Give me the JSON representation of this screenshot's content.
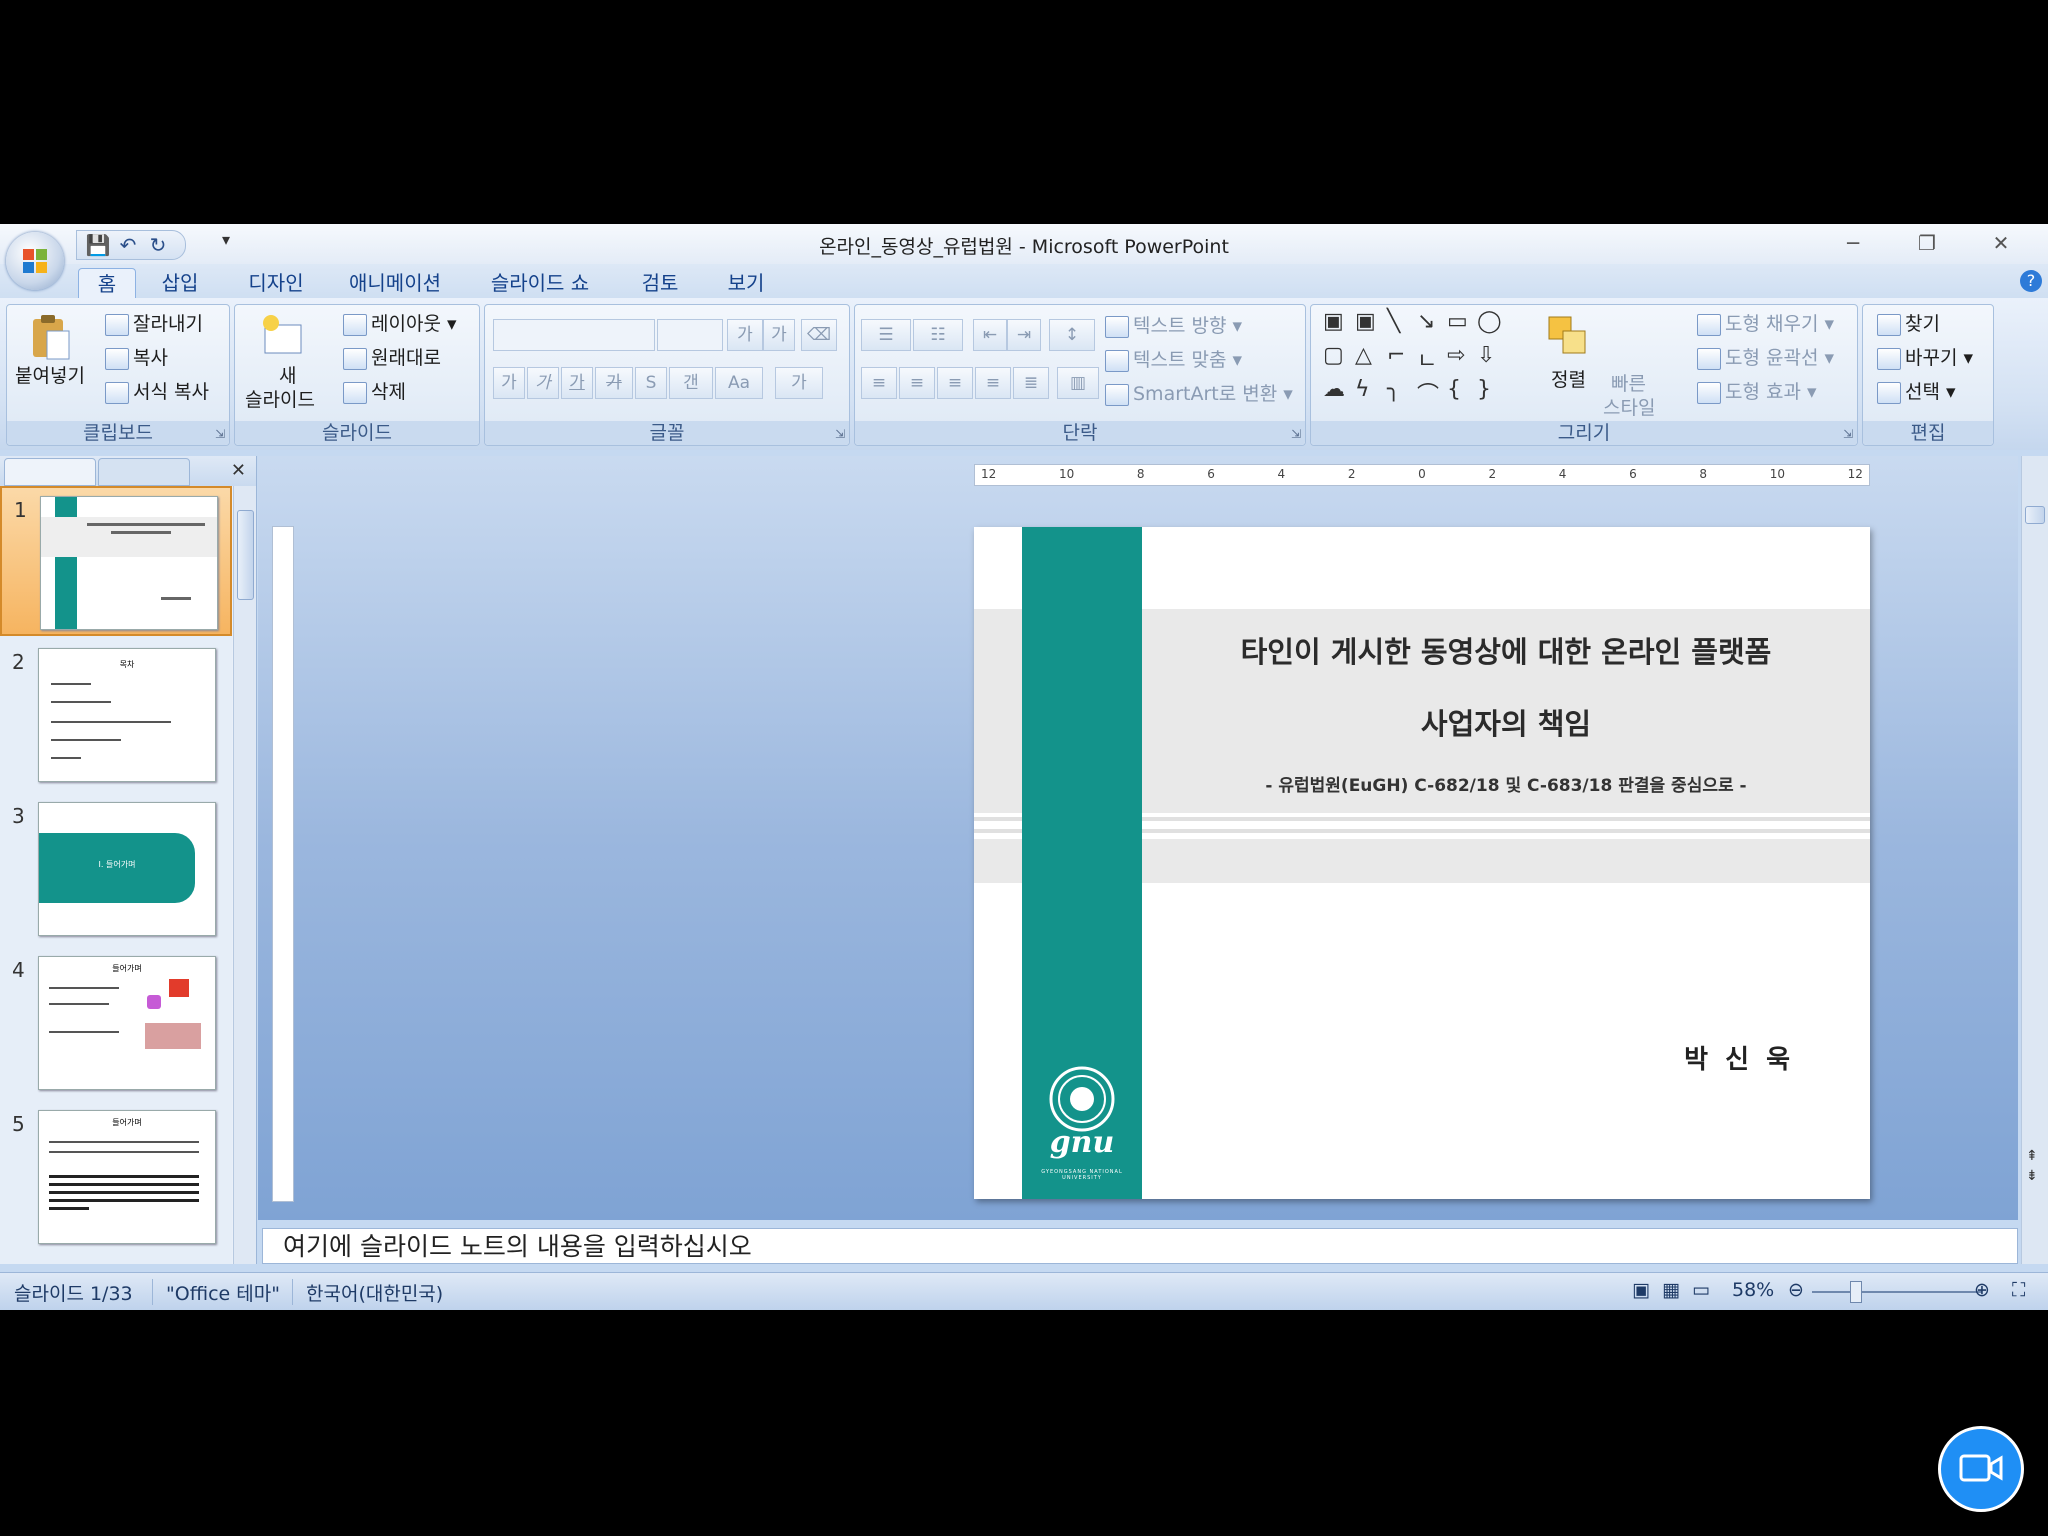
{
  "window": {
    "title": "온라인_동영상_유럽법원 - Microsoft PowerPoint",
    "controls": [
      "─",
      "❐",
      "✕"
    ]
  },
  "qat": {
    "more": "▾"
  },
  "tabs": [
    "홈",
    "삽입",
    "디자인",
    "애니메이션",
    "슬라이드 쇼",
    "검토",
    "보기"
  ],
  "ribbon": {
    "clipboard": {
      "label": "클립보드",
      "paste": "붙여넣기",
      "cut": "잘라내기",
      "copy": "복사",
      "format_painter": "서식 복사"
    },
    "slides": {
      "label": "슬라이드",
      "new_slide_1": "새",
      "new_slide_2": "슬라이드",
      "layout": "레이아웃",
      "reset": "원래대로",
      "delete": "삭제"
    },
    "font": {
      "label": "글꼴",
      "bold": "가",
      "italic": "가",
      "underline": "가",
      "strike": "가",
      "shadow": "S",
      "spacing": "갠",
      "case": "Aa",
      "color": "가"
    },
    "paragraph": {
      "label": "단락",
      "text_direction": "텍스트 방향",
      "align_text": "텍스트 맞춤",
      "smartart": "SmartArt로 변환"
    },
    "drawing": {
      "label": "그리기",
      "arrange": "정렬",
      "quick_styles_1": "빠른",
      "quick_styles_2": "스타일",
      "fill": "도형 채우기",
      "outline": "도형 윤곽선",
      "effects": "도형 효과"
    },
    "editing": {
      "label": "편집",
      "find": "찾기",
      "replace": "바꾸기",
      "select": "선택"
    }
  },
  "slides_panel": {
    "thumbnails": [
      {
        "num": "1",
        "title": "",
        "selected": true
      },
      {
        "num": "2",
        "title": "목차",
        "selected": false
      },
      {
        "num": "3",
        "title": "I. 들어가며",
        "selected": false
      },
      {
        "num": "4",
        "title": "들어가며",
        "selected": false
      },
      {
        "num": "5",
        "title": "들어가며",
        "selected": false
      }
    ]
  },
  "ruler": {
    "h_ticks": [
      "12",
      "10",
      "8",
      "6",
      "4",
      "2",
      "0",
      "2",
      "4",
      "6",
      "8",
      "10",
      "12"
    ]
  },
  "slide": {
    "title_line1": "타인이 게시한 동영상에 대한 온라인 플랫폼",
    "title_line2": "사업자의 책임",
    "subtitle": "- 유럽법원(EuGH) C-682/18 및 C-683/18 판결을 중심으로 -",
    "author": "박 신 욱",
    "logo_text": "gnu",
    "logo_caption": "GYEONGSANG NATIONAL UNIVERSITY",
    "accent_color": "#13938b"
  },
  "notes": {
    "placeholder": "여기에 슬라이드 노트의 내용을 입력하십시오"
  },
  "status": {
    "slide_count": "슬라이드 1/33",
    "theme": "\"Office 테마\"",
    "language": "한국어(대한민국)",
    "zoom": "58%"
  }
}
